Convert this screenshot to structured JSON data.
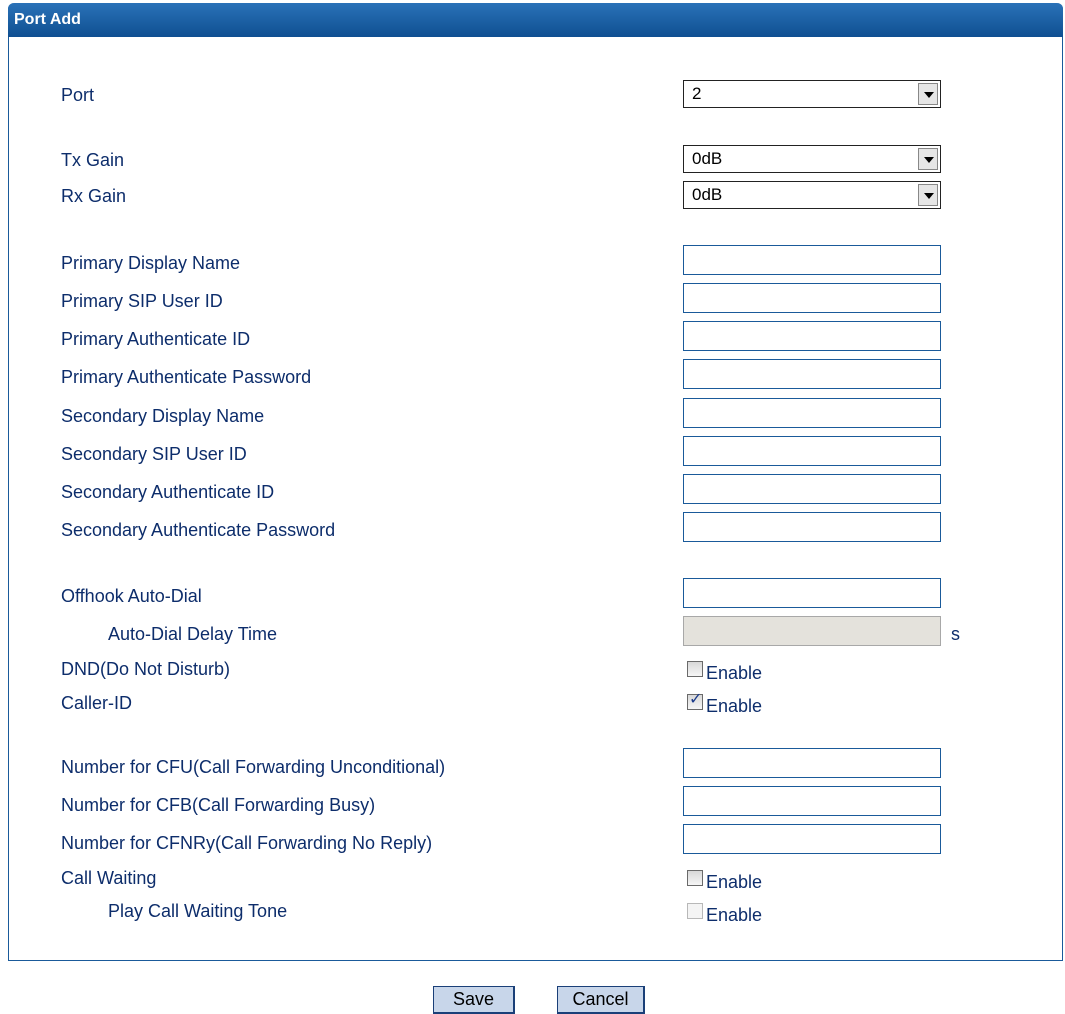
{
  "panel": {
    "title": "Port Add"
  },
  "fields": {
    "port": {
      "label": "Port",
      "value": "2"
    },
    "tx_gain": {
      "label": "Tx Gain",
      "value": "0dB"
    },
    "rx_gain": {
      "label": "Rx Gain",
      "value": "0dB"
    },
    "primary_display_name": {
      "label": "Primary Display Name",
      "value": ""
    },
    "primary_sip_user_id": {
      "label": "Primary SIP User ID",
      "value": ""
    },
    "primary_auth_id": {
      "label": "Primary Authenticate ID",
      "value": ""
    },
    "primary_auth_password": {
      "label": "Primary Authenticate Password",
      "value": ""
    },
    "secondary_display_name": {
      "label": "Secondary Display Name",
      "value": ""
    },
    "secondary_sip_user_id": {
      "label": "Secondary SIP User ID",
      "value": ""
    },
    "secondary_auth_id": {
      "label": "Secondary Authenticate ID",
      "value": ""
    },
    "secondary_auth_password": {
      "label": "Secondary Authenticate Password",
      "value": ""
    },
    "offhook_auto_dial": {
      "label": "Offhook Auto-Dial",
      "value": ""
    },
    "auto_dial_delay": {
      "label": "Auto-Dial Delay Time",
      "value": "",
      "unit": "s",
      "disabled": true
    },
    "dnd": {
      "label": "DND(Do Not Disturb)",
      "option": "Enable",
      "checked": false
    },
    "caller_id": {
      "label": "Caller-ID",
      "option": "Enable",
      "checked": true
    },
    "cfu": {
      "label": "Number for CFU(Call Forwarding Unconditional)",
      "value": ""
    },
    "cfb": {
      "label": "Number for CFB(Call Forwarding Busy)",
      "value": ""
    },
    "cfnry": {
      "label": "Number for CFNRy(Call Forwarding No Reply)",
      "value": ""
    },
    "call_waiting": {
      "label": "Call Waiting",
      "option": "Enable",
      "checked": false
    },
    "call_waiting_tone": {
      "label": "Play Call Waiting Tone",
      "option": "Enable",
      "checked": false,
      "disabled": true
    }
  },
  "buttons": {
    "save": "Save",
    "cancel": "Cancel"
  },
  "colors": {
    "header": "#1a5a9a",
    "label_text": "#0d2d6b",
    "button_bg": "#c8d6ea"
  }
}
